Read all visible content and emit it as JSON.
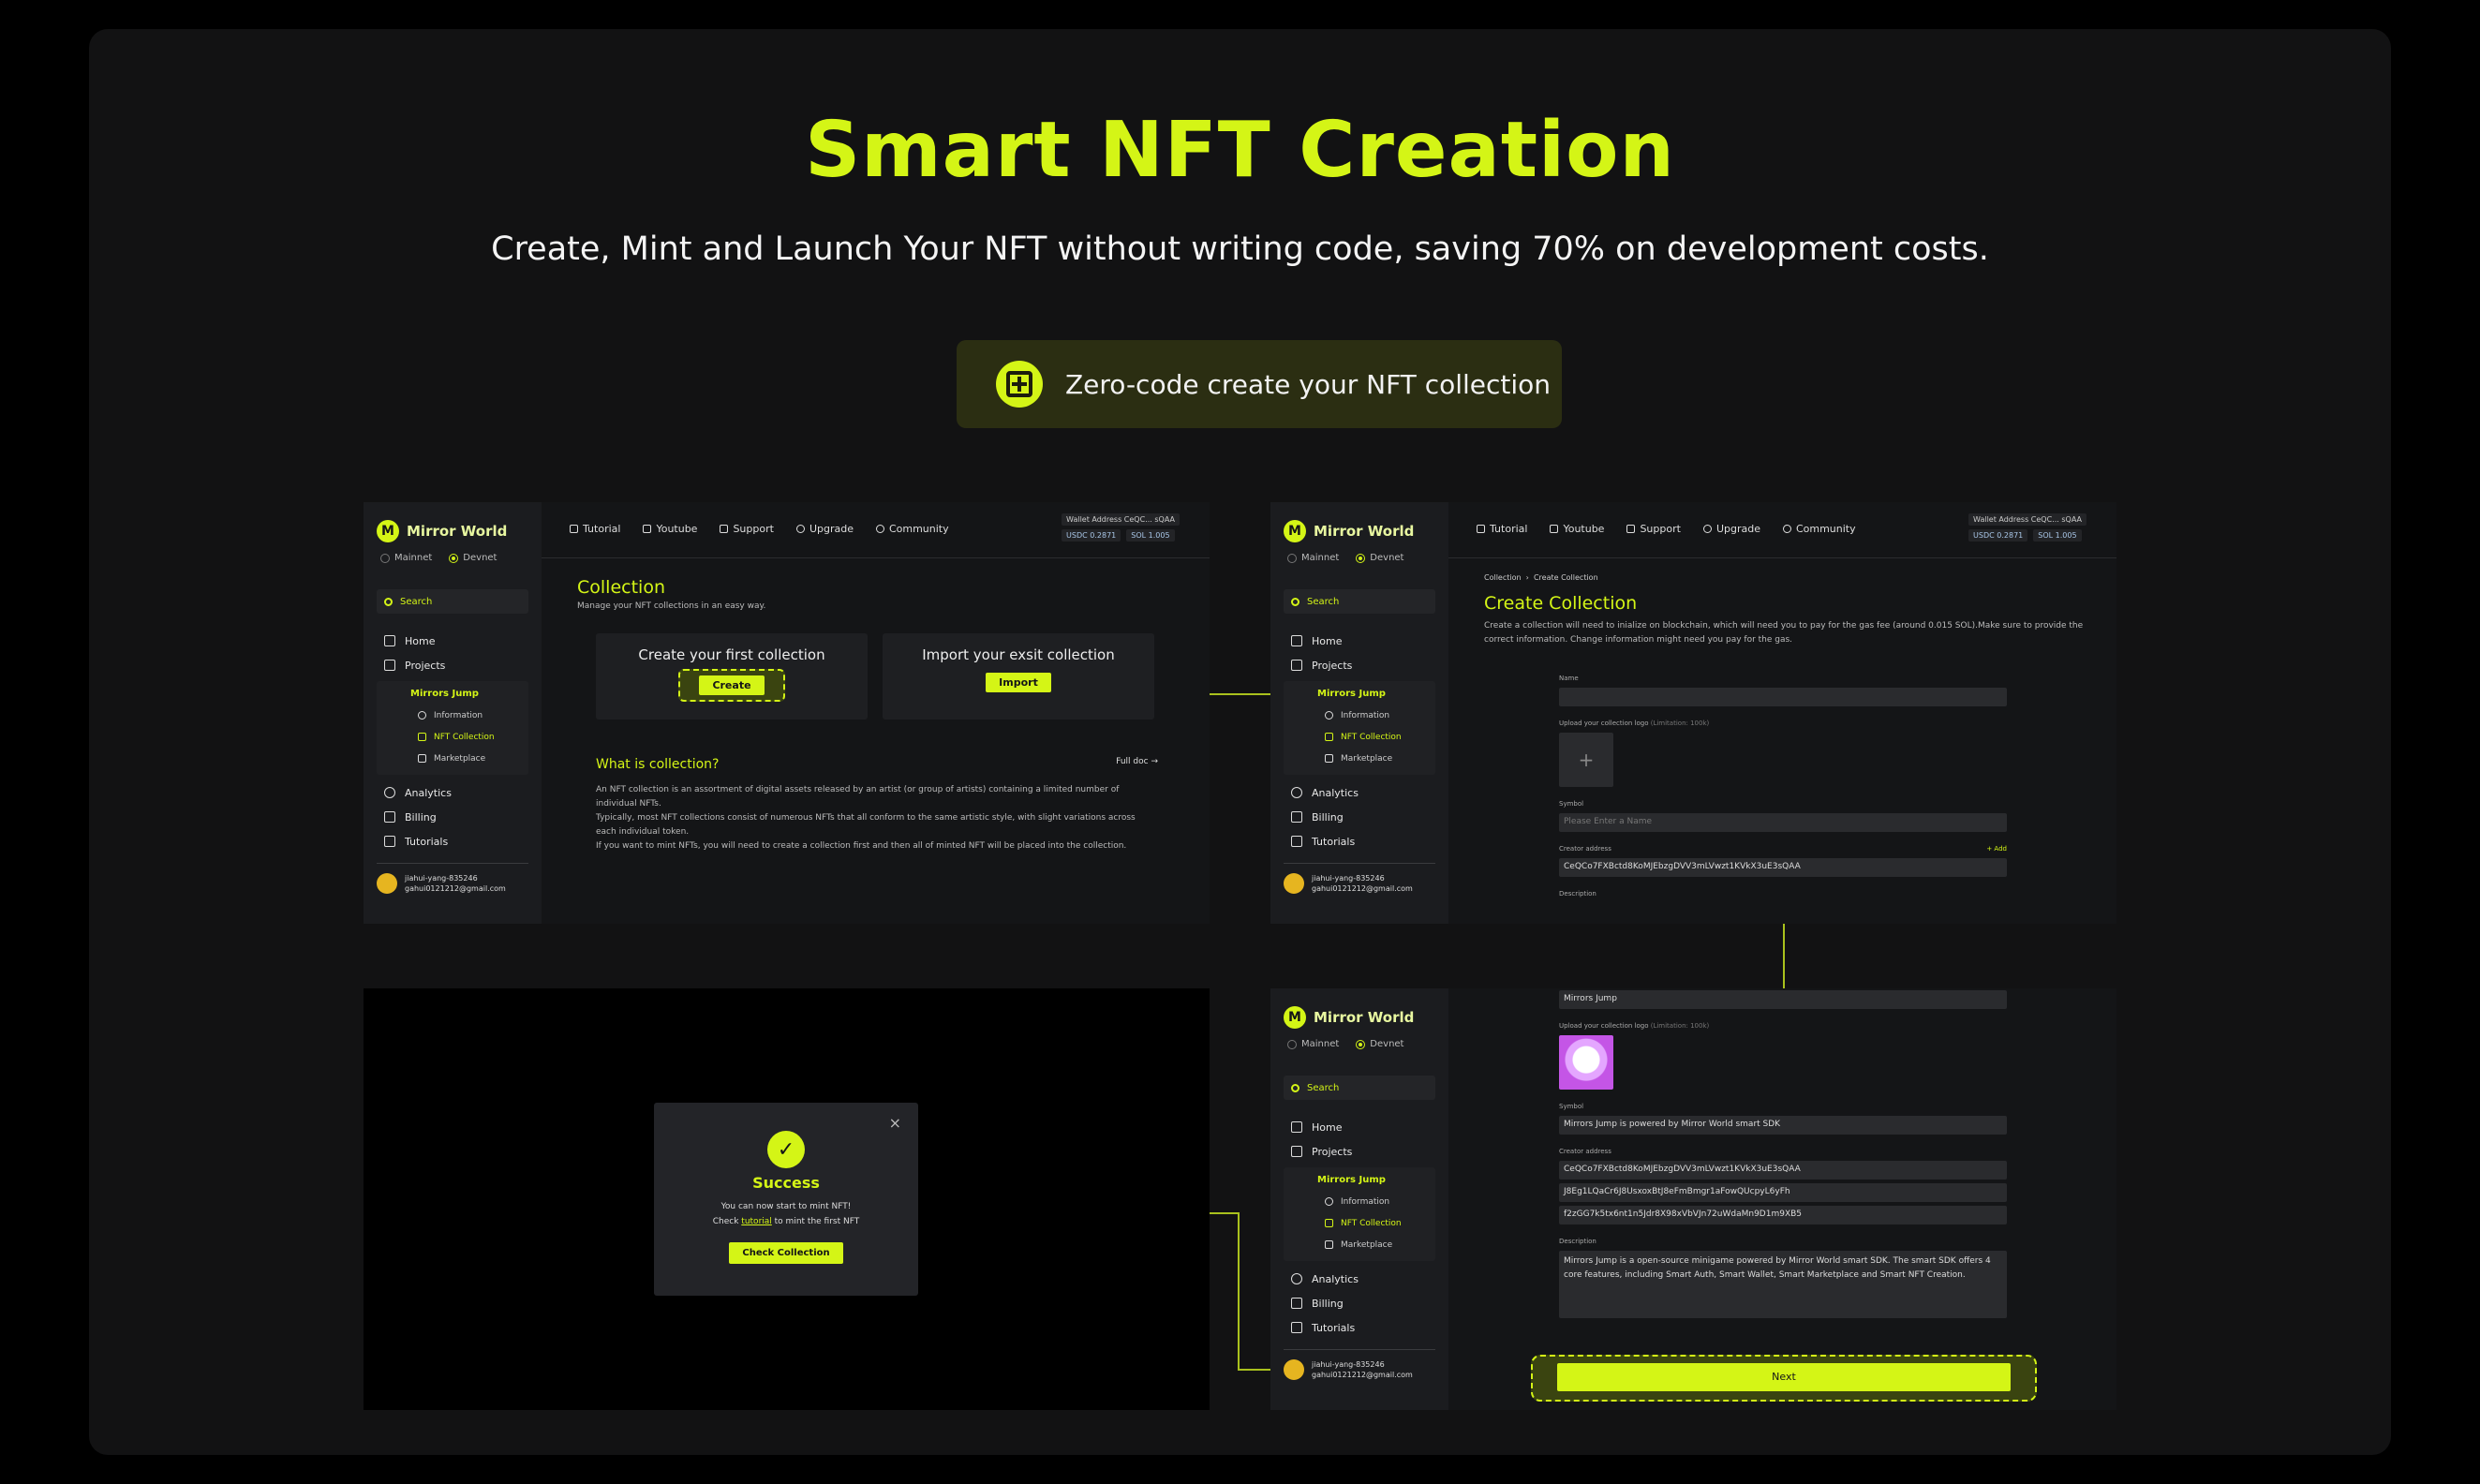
{
  "hero": {
    "title": "Smart NFT Creation",
    "subtitle": "Create, Mint and Launch Your NFT without writing code, saving 70% on development costs.",
    "badge": "Zero-code create your NFT collection"
  },
  "app": {
    "logo": "Mirror World",
    "networks": [
      "Mainnet",
      "Devnet"
    ],
    "search": "Search",
    "nav": [
      "Home",
      "Projects"
    ],
    "project": "Mirrors Jump",
    "project_items": [
      "Information",
      "NFT Collection",
      "Marketplace"
    ],
    "nav2": [
      "Analytics",
      "Billing",
      "Tutorials"
    ],
    "user_name": "jiahui-yang-835246",
    "user_email": "gahui0121212@gmail.com",
    "top_nav": [
      "Tutorial",
      "Youtube",
      "Support",
      "Upgrade",
      "Community"
    ],
    "wallet": "Wallet Address  CeQC... sQAA",
    "usdc": "USDC  0.2871",
    "sol": "SOL  1.005"
  },
  "collection": {
    "title": "Collection",
    "subtitle": "Manage your NFT collections in an easy way.",
    "create_title": "Create your first collection",
    "create_btn": "Create",
    "import_title": "Import your exsit collection",
    "import_btn": "Import",
    "what_title": "What is collection?",
    "full_doc": "Full doc →",
    "p1": "An NFT collection is an assortment of digital assets released by an artist (or group of artists) containing a limited number of individual NFTs.",
    "p2": "Typically, most NFT collections consist of numerous NFTs that all conform to the same artistic style, with slight variations across each individual token.",
    "p3": "If you want to mint NFTs, you will need to create a collection first and then all of minted NFT will be placed into the collection."
  },
  "create": {
    "breadcrumb1": "Collection",
    "breadcrumb2": "Create Collection",
    "title": "Create Collection",
    "desc": "Create a collection will need to inialize on blockchain, which will need you to pay for the gas fee (around 0.015 SOL).Make sure to provide the correct information. Change information might need you pay for the gas.",
    "name_label": "Name",
    "logo_label": "Upload your collection logo",
    "logo_hint": "(Limitation: 100k)",
    "symbol_label": "Symbol",
    "symbol_ph": "Please Enter a Name",
    "creator_label": "Creator address",
    "add": "+ Add",
    "creator_value": "CeQCo7FXBctd8KoMJEbzgDVV3mLVwzt1KVkX3uE3sQAA",
    "desc_label": "Description"
  },
  "filled": {
    "name_value": "Mirrors Jump",
    "logo_label": "Upload your collection logo",
    "logo_hint": "(Limitation: 100k)",
    "symbol_label": "Symbol",
    "symbol_value": "Mirrors Jump is powered by Mirror World smart SDK",
    "creator_label": "Creator address",
    "creators": [
      "CeQCo7FXBctd8KoMJEbzgDVV3mLVwzt1KVkX3uE3sQAA",
      "J8Eg1LQaCr6J8UsxoxBtJ8eFmBmgr1aFowQUcpyL6yFh",
      "f2zGG7k5tx6nt1n5Jdr8X98xVbVJn72uWdaMn9D1m9XB5"
    ],
    "desc_label": "Description",
    "desc_value": "Mirrors Jump is a open-source minigame powered by Mirror World smart SDK.  The smart SDK offers 4 core features, including Smart Auth, Smart Wallet, Smart Marketplace and Smart NFT Creation.",
    "next": "Next"
  },
  "success": {
    "title": "Success",
    "line1": "You can now start to mint NFT!",
    "line2a": "Check",
    "link": "tutorial",
    "line2b": "to mint the first NFT",
    "button": "Check Collection",
    "close": "×"
  }
}
